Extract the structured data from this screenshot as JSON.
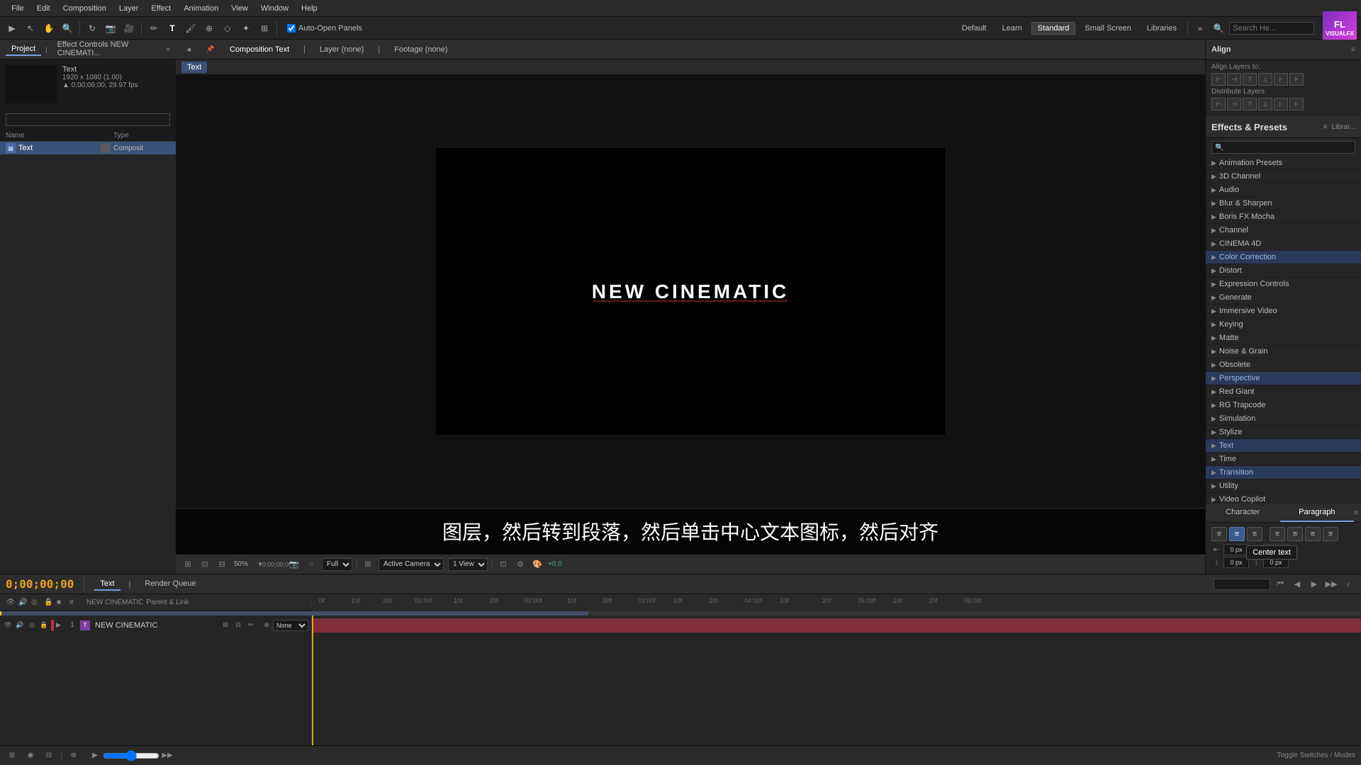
{
  "menu": {
    "items": [
      "File",
      "Edit",
      "Composition",
      "Layer",
      "Effect",
      "Animation",
      "View",
      "Window",
      "Help"
    ]
  },
  "toolbar": {
    "auto_open_label": "Auto-Open Panels",
    "workspaces": [
      "Default",
      "Learn",
      "Standard",
      "Small Screen",
      "Libraries"
    ],
    "active_workspace": "Standard",
    "search_placeholder": "Search He..."
  },
  "project_panel": {
    "title": "Project",
    "tab": "Effect Controls NEW CINEMATI...",
    "preview_info_line1": "Text",
    "preview_info_line2": "1920 x 1080 (1.00)",
    "preview_info_line3": "▲ 0;00;06;00, 29.97 fps",
    "search_placeholder": "",
    "columns": {
      "name": "Name",
      "type": "Type"
    },
    "items": [
      {
        "name": "Text",
        "type": "Composit"
      }
    ]
  },
  "composition": {
    "tabs": [
      "Composition Text",
      "Layer (none)",
      "Footage (none)"
    ],
    "active_tab": "Composition Text",
    "sub_tab": "Text",
    "viewer_text": "NEW CINEMATIC",
    "controls": {
      "zoom": "50%",
      "timecode": "0;00;00;00",
      "quality": "Full",
      "camera": "Active Camera",
      "view": "1 View",
      "green_value": "+0.0"
    }
  },
  "subtitle": {
    "text": "图层，然后转到段落，然后单击中心文本图标，然后对齐"
  },
  "timeline": {
    "current_time": "0;00;00;00",
    "comp_name": "Text",
    "render_queue": "Render Queue",
    "layers": [
      {
        "number": "1",
        "name": "NEW CINEMATIC",
        "parent": "None",
        "mode": ""
      }
    ],
    "footer": "Toggle Switches / Modes"
  },
  "effects_panel": {
    "title": "Effects & Presets",
    "search_placeholder": "🔍",
    "categories": [
      {
        "name": "Animation Presets",
        "highlighted": false
      },
      {
        "name": "3D Channel",
        "highlighted": false
      },
      {
        "name": "Audio",
        "highlighted": false
      },
      {
        "name": "Blur & Sharpen",
        "highlighted": false
      },
      {
        "name": "Boris FX Mocha",
        "highlighted": false
      },
      {
        "name": "Channel",
        "highlighted": false
      },
      {
        "name": "CINEMA 4D",
        "highlighted": false
      },
      {
        "name": "Color Correction",
        "highlighted": true
      },
      {
        "name": "Distort",
        "highlighted": false
      },
      {
        "name": "Expression Controls",
        "highlighted": false
      },
      {
        "name": "Generate",
        "highlighted": false
      },
      {
        "name": "Immersive Video",
        "highlighted": false
      },
      {
        "name": "Keying",
        "highlighted": false
      },
      {
        "name": "Matte",
        "highlighted": false
      },
      {
        "name": "Noise & Grain",
        "highlighted": false
      },
      {
        "name": "Obsolete",
        "highlighted": false
      },
      {
        "name": "Perspective",
        "highlighted": true
      },
      {
        "name": "Red Giant",
        "highlighted": false
      },
      {
        "name": "RG Trapcode",
        "highlighted": false
      },
      {
        "name": "Simulation",
        "highlighted": false
      },
      {
        "name": "Stylize",
        "highlighted": false
      },
      {
        "name": "Text",
        "highlighted": true
      },
      {
        "name": "Time",
        "highlighted": false
      },
      {
        "name": "Transition",
        "highlighted": true
      },
      {
        "name": "Utility",
        "highlighted": false
      },
      {
        "name": "Video Copilot",
        "highlighted": false
      }
    ]
  },
  "align_panel": {
    "title": "Align",
    "align_layers_to": "Align Layers to:",
    "distribute_title": "Distribute Layers"
  },
  "character_paragraph": {
    "tabs": [
      "Character",
      "Paragraph"
    ],
    "active_tab": "Paragraph",
    "align_buttons": [
      "left",
      "center",
      "right",
      "justify-left",
      "justify-center",
      "justify-right",
      "justify-all"
    ],
    "center_text_tooltip": "Center text",
    "numbers": [
      "0 px",
      "0 px",
      "0 px",
      "0 px"
    ]
  },
  "logo": {
    "line1": "FL",
    "line2": "VISUALFX"
  }
}
